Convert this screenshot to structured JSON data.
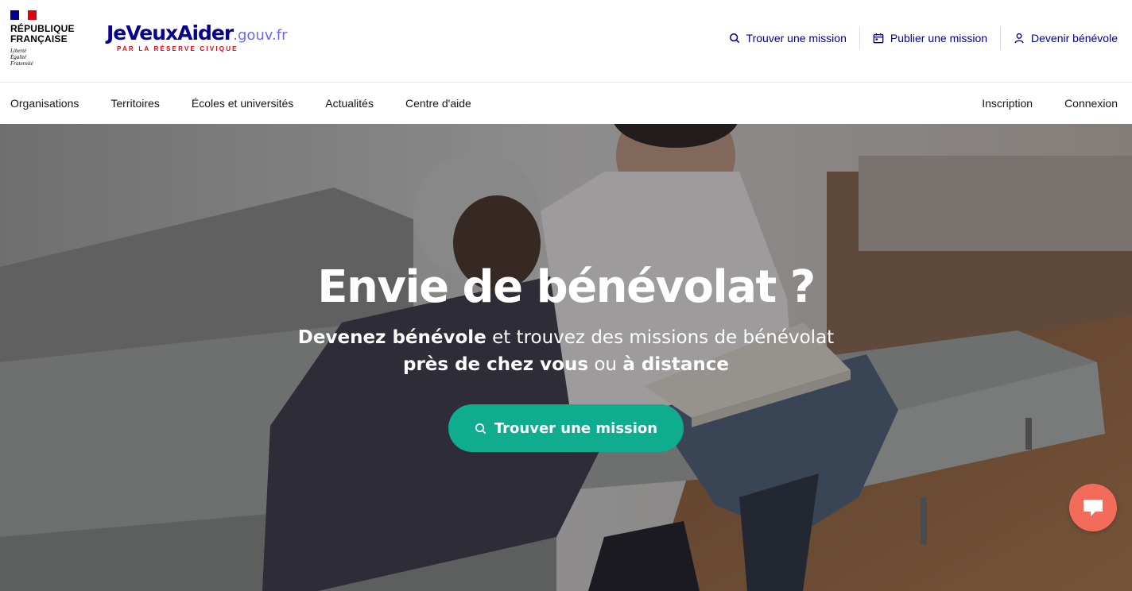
{
  "header": {
    "republic": {
      "name": "RÉPUBLIQUE\nFRANÇAISE",
      "motto": "Liberté\nÉgalité\nFraternité",
      "flag_colors": [
        "#000091",
        "#ffffff",
        "#e1000f"
      ]
    },
    "brand": {
      "main": "JeVeuxAider",
      "domain": ".gouv.fr",
      "tagline": "PAR LA RÉSERVE CIVIQUE"
    },
    "links": [
      {
        "label": "Trouver une mission",
        "icon": "search-icon"
      },
      {
        "label": "Publier une mission",
        "icon": "calendar-icon"
      },
      {
        "label": "Devenir bénévole",
        "icon": "user-icon"
      }
    ]
  },
  "nav": {
    "left": [
      "Organisations",
      "Territoires",
      "Écoles et universités",
      "Actualités",
      "Centre d'aide"
    ],
    "right": [
      "Inscription",
      "Connexion"
    ]
  },
  "hero": {
    "title": "Envie de bénévolat ?",
    "subtitle_line1_bold": "Devenez bénévole",
    "subtitle_line1_rest": " et trouvez des missions de bénévolat",
    "subtitle_line2_bold1": "près de chez vous",
    "subtitle_line2_mid": " ou ",
    "subtitle_line2_bold2": "à distance",
    "cta_label": "Trouver une mission",
    "cta_icon": "search-icon"
  },
  "chat": {
    "icon": "chat-bubble-icon"
  },
  "colors": {
    "primary_blue": "#000091",
    "cta_green": "#10ac8f",
    "chat_coral": "#f26b5b",
    "brand_red": "#e1000f"
  }
}
